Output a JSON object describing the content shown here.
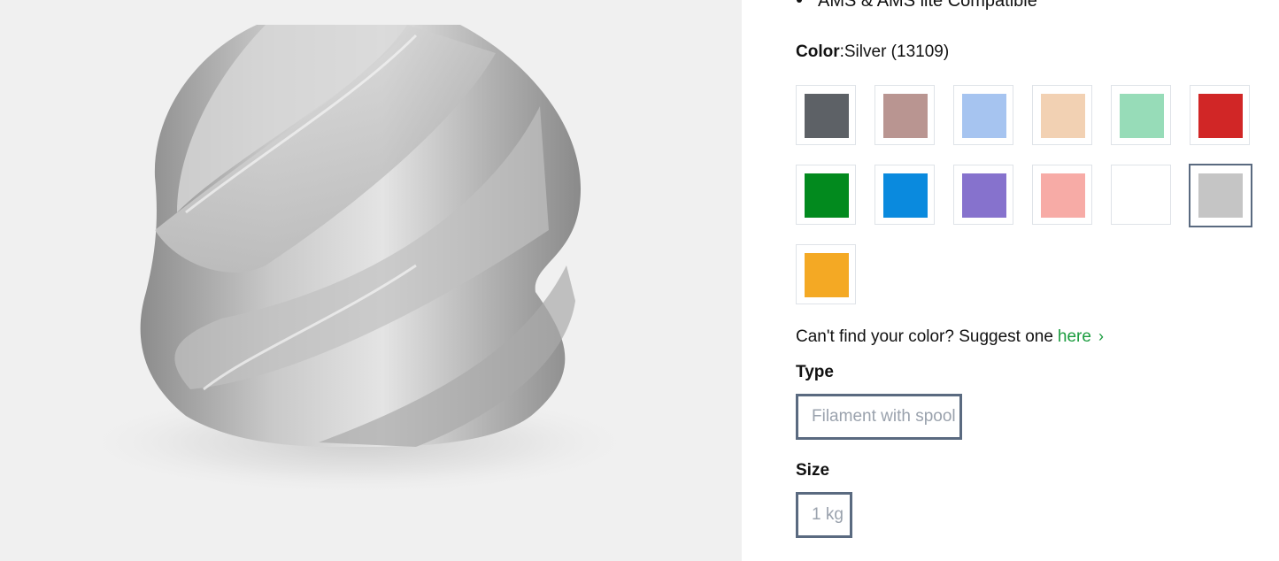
{
  "product": {
    "feature_bullet": "AMS & AMS lite Compatible"
  },
  "color": {
    "label": "Color",
    "selected_value": ":Silver (13109)",
    "swatches": [
      {
        "color": "#5d6166"
      },
      {
        "color": "#b99591"
      },
      {
        "color": "#a6c4f0"
      },
      {
        "color": "#f2d1b3"
      },
      {
        "color": "#97dcb8"
      },
      {
        "color": "#d12626"
      },
      {
        "color": "#028a1e"
      },
      {
        "color": "#0a8ade"
      },
      {
        "color": "#8672cd"
      },
      {
        "color": "#f7aba6"
      },
      {
        "color": "#ffffff"
      },
      {
        "color": "#c5c5c5",
        "selected": true
      },
      {
        "color": "#f4a924"
      }
    ]
  },
  "suggest": {
    "text": "Can't find your color? Suggest one",
    "link": "here"
  },
  "type": {
    "label": "Type",
    "option": "Filament with spool"
  },
  "size": {
    "label": "Size",
    "option": "1 kg"
  }
}
